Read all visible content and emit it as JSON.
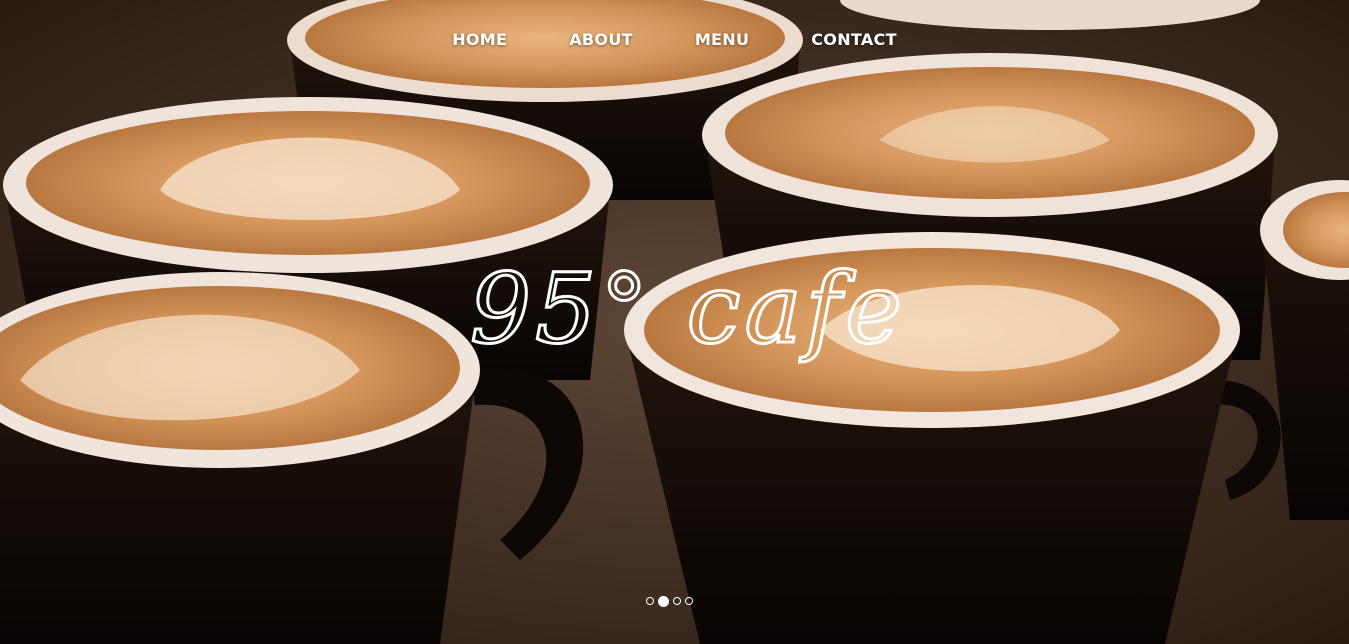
{
  "nav": {
    "items": [
      {
        "label": "HOME"
      },
      {
        "label": "ABOUT"
      },
      {
        "label": "MENU"
      },
      {
        "label": "CONTACT"
      }
    ]
  },
  "hero": {
    "logo_text": "95° cafe",
    "background": "latte-art coffee cups photo"
  },
  "slider": {
    "slide_count": 4,
    "active_index": 1
  },
  "colors": {
    "text": "#ffffff",
    "foam": "#d9a06a",
    "cup": "#140c08",
    "rim": "#efe6df"
  }
}
